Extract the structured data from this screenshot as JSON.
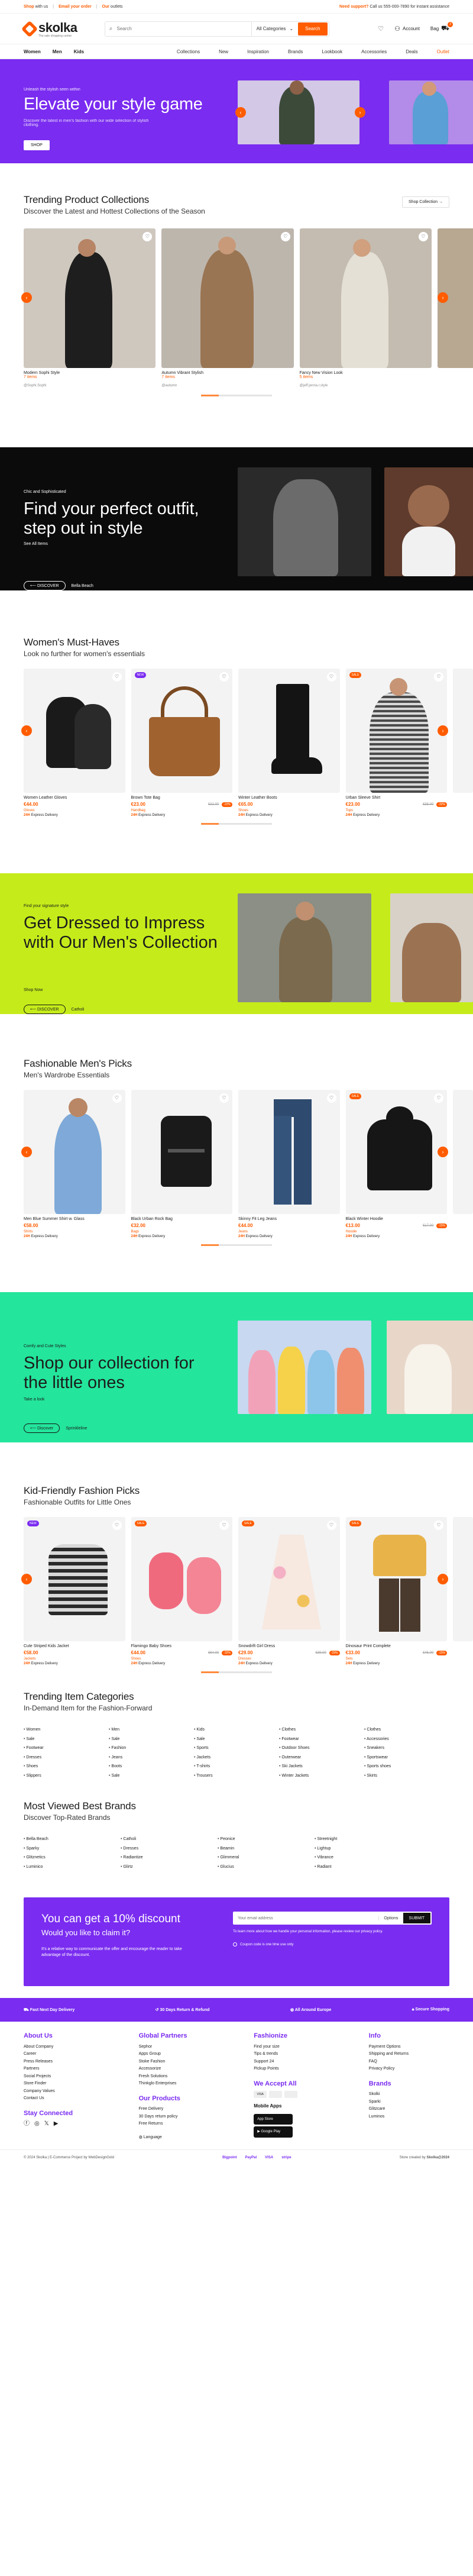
{
  "topbar": {
    "left1_bold": "Shop",
    "left1": " with us",
    "left2_bold": "Email your order",
    "left3_bold": "Our",
    "left3": " outlets",
    "support_bold": "Need support?",
    "support": "Call us 555-000-7890 for instant assistance"
  },
  "header": {
    "logo": "skolka",
    "logo_sub": "The sale shopping center",
    "search_placeholder": "Search",
    "category": "All Categories",
    "search_button": "Search",
    "account": "Account",
    "bag": "Bag",
    "cart_count": "3"
  },
  "nav": {
    "gender": [
      "Women",
      "Men",
      "Kids"
    ],
    "categories": [
      "Collections",
      "New",
      "Inspiration",
      "Brands",
      "Lookbook",
      "Accessories",
      "Deals",
      "Outlet"
    ]
  },
  "hero": {
    "eyebrow": "Unleash the stylish seen within",
    "title": "Elevate your style game",
    "desc": "Discover the latest in men's fashion with our wide selection of stylish clothing.",
    "button": "SHOP"
  },
  "trending": {
    "title": "Trending Product Collections",
    "subtitle": "Discover the Latest and Hottest Collections of the Season",
    "shop_btn": "Shop Collection  →",
    "cards": [
      {
        "name": "Modern Sophi Style",
        "count": "7 items",
        "by": "@Sophi.Sophi"
      },
      {
        "name": "Autumn Vibrant Stylish",
        "count": "7 items",
        "by": "@autumn"
      },
      {
        "name": "Fancy New Vision Look",
        "count": "5 items",
        "by": "@jeff.jenna.r.style"
      }
    ]
  },
  "banner1": {
    "eyebrow": "Chic and Sophisticated",
    "title": "Find your perfect outfit, step out in style",
    "link": "See All Items",
    "pill": "DISCOVER",
    "brand": "Bella Beach"
  },
  "women": {
    "title": "Women's Must-Haves",
    "subtitle": "Look no further for women's essentials",
    "items": [
      {
        "name": "Women Leather Gloves",
        "price": "€44.00",
        "label": "Gloves",
        "deliv_b": "24H",
        "deliv": " Express Delivery",
        "tag": ""
      },
      {
        "name": "Brown Tote Bag",
        "price": "€23.00",
        "old": "€32.00",
        "disc": "-22%",
        "label": "Handbag",
        "deliv_b": "24H",
        "deliv": " Express Delivery",
        "tag": "NEW"
      },
      {
        "name": "Winter Leather Boots",
        "price": "€65.00",
        "label": "Shoes",
        "deliv_b": "24H",
        "deliv": " Express Delivery",
        "tag": ""
      },
      {
        "name": "Urban Sleeve Shirt",
        "price": "€23.00",
        "old": "€35.00",
        "disc": "-32%",
        "label": "Tops",
        "deliv_b": "24H",
        "deliv": " Express Delivery",
        "tag": "SALE"
      }
    ]
  },
  "banner2": {
    "eyebrow": "Find your signature style",
    "title": "Get Dressed to Impress with Our Men's Collection",
    "link": "Shop Now",
    "pill": "DISCOVER",
    "brand": "Catholi"
  },
  "men": {
    "title": "Fashionable Men's Picks",
    "subtitle": "Men's Wardrobe Essentials",
    "items": [
      {
        "name": "Men Blue Summer Shirt w. Glass",
        "price": "€58.00",
        "label": "Shirts",
        "deliv_b": "24H",
        "deliv": " Express Delivery",
        "tag": ""
      },
      {
        "name": "Black Urban Rock Bag",
        "price": "€32.00",
        "label": "Bags",
        "deliv_b": "24H",
        "deliv": " Express Delivery",
        "tag": ""
      },
      {
        "name": "Skinny Fit Leg Jeans",
        "price": "€44.00",
        "label": "Jeans",
        "deliv_b": "24H",
        "deliv": " Express Delivery",
        "tag": ""
      },
      {
        "name": "Black Winter Hoodie",
        "price": "€13.00",
        "old": "€17.00",
        "disc": "-15%",
        "label": "Hoodie",
        "deliv_b": "24H",
        "deliv": " Express Delivery",
        "tag": "SALE"
      }
    ]
  },
  "banner3": {
    "eyebrow": "Comfy and Cute Styles",
    "title": "Shop our collection for the little ones",
    "link": "Take a look",
    "pill": "Discover",
    "brand": "Sprinkleline"
  },
  "kids": {
    "title": "Kid-Friendly Fashion Picks",
    "subtitle": "Fashionable Outfits for Little Ones",
    "items": [
      {
        "name": "Cute Striped Kids Jacket",
        "price": "€58.00",
        "label": "Jackets",
        "deliv_b": "24H",
        "deliv": " Express Delivery",
        "tag": "NEW"
      },
      {
        "name": "Flamingo Baby Shoes",
        "price": "€44.00",
        "old": "€64.00",
        "disc": "-32%",
        "label": "Shoes",
        "deliv_b": "24H",
        "deliv": " Express Delivery",
        "tag": "SALE"
      },
      {
        "name": "Snowdrift Girl Dress",
        "price": "€29.00",
        "old": "€39.00",
        "disc": "-29%",
        "label": "Dresses",
        "deliv_b": "24H",
        "deliv": " Express Delivery",
        "tag": "SALE"
      },
      {
        "name": "Dinosaur Print Complete",
        "price": "€33.00",
        "old": "€45.00",
        "disc": "-15%",
        "label": "Sets",
        "deliv_b": "24H",
        "deliv": " Express Delivery",
        "tag": "SALE"
      }
    ]
  },
  "categories": {
    "title": "Trending Item Categories",
    "subtitle": "In-Demand Item for the Fashion-Forward",
    "cols": [
      [
        "Women",
        "Sale",
        "Footwear",
        "Dresses",
        "Shoes",
        "Slippers"
      ],
      [
        "Men",
        "Sale",
        "Fashion",
        "Jeans",
        "Boots",
        "Sale"
      ],
      [
        "Kids",
        "Sale",
        "Sports",
        "Jackets",
        "T-shirts",
        "Trousers"
      ],
      [
        "Clothes",
        "Footwear",
        "Outdoor Shoes",
        "Outerwear",
        "Ski Jackets",
        "Winter Jackets"
      ],
      [
        "Clothes",
        "Accessories",
        "Sneakers",
        "Sportswear",
        "Sports shoes",
        "Skirts"
      ]
    ]
  },
  "brands": {
    "title": "Most Viewed Best Brands",
    "subtitle": "Discover Top-Rated Brands",
    "cols": [
      [
        "Bella Beach",
        "Sparky",
        "Glitznetics",
        "Luminico"
      ],
      [
        "Catholi",
        "Dresses",
        "Radiantize",
        "Glirtz"
      ],
      [
        "Peonice",
        "Beamin",
        "Glimmeral",
        "Glucius"
      ],
      [
        "Streetnight",
        "Lightup",
        "Vibrance",
        "Radiant"
      ]
    ]
  },
  "newsletter": {
    "title": "You can get a 10% discount",
    "subtitle": "Would you like to claim it?",
    "desc": "It's a relative way to communicate the offer and encourage the reader to take advantage of the discount.",
    "placeholder": "Your email address",
    "option": "Options",
    "submit": "SUBMIT",
    "info": "To learn more about how we handle your personal information, please review our privacy policy.",
    "check": "Coupon code is one time use only"
  },
  "perks": [
    "Fast Next Day Delivery",
    "30 Days Return & Refund",
    "All Around Europe",
    "Secure Shopping"
  ],
  "footer": {
    "cols": [
      {
        "title": "About Us",
        "items": [
          "About Company",
          "Career",
          "Press Releases",
          "Partners",
          "Social Projects",
          "Store Finder",
          "Company Values",
          "Contact Us"
        ]
      },
      {
        "title": "Global Partners",
        "items": [
          "Sephor",
          "Apps Group",
          "Stoke Fashion",
          "Accessorize",
          "Fresh Solutions",
          "Thinkglo Enterprises"
        ]
      },
      {
        "title": "Fashionize",
        "items": [
          "Find your size",
          "Tips & trends",
          "Support 24",
          "Pickup Points"
        ]
      },
      {
        "title": "Info",
        "items": [
          "Payment Options",
          "Shipping and Returns",
          "FAQ",
          "Privacy Policy"
        ]
      }
    ],
    "stay": "Stay Connected",
    "products_title": "Our Products",
    "products": [
      "Free Delivery",
      "30 Days return policy",
      "Free Returns"
    ],
    "accept": "We Accept All",
    "mobile": "Mobile Apps",
    "appstore": "App Store",
    "gplay": "Google Play",
    "brands_title": "Brands",
    "brands": [
      "Skolki",
      "Sparki",
      "Glitzcare",
      "Luminos"
    ],
    "language": "Language",
    "copyright": "© 2024 Skolka | E-Commerce Project by WebDesignGold",
    "credit": "Store created by ",
    "credit_b": "Skolka@2024",
    "payments": [
      "Bigpoint",
      "PayPal",
      "VISA",
      "stripe"
    ]
  }
}
